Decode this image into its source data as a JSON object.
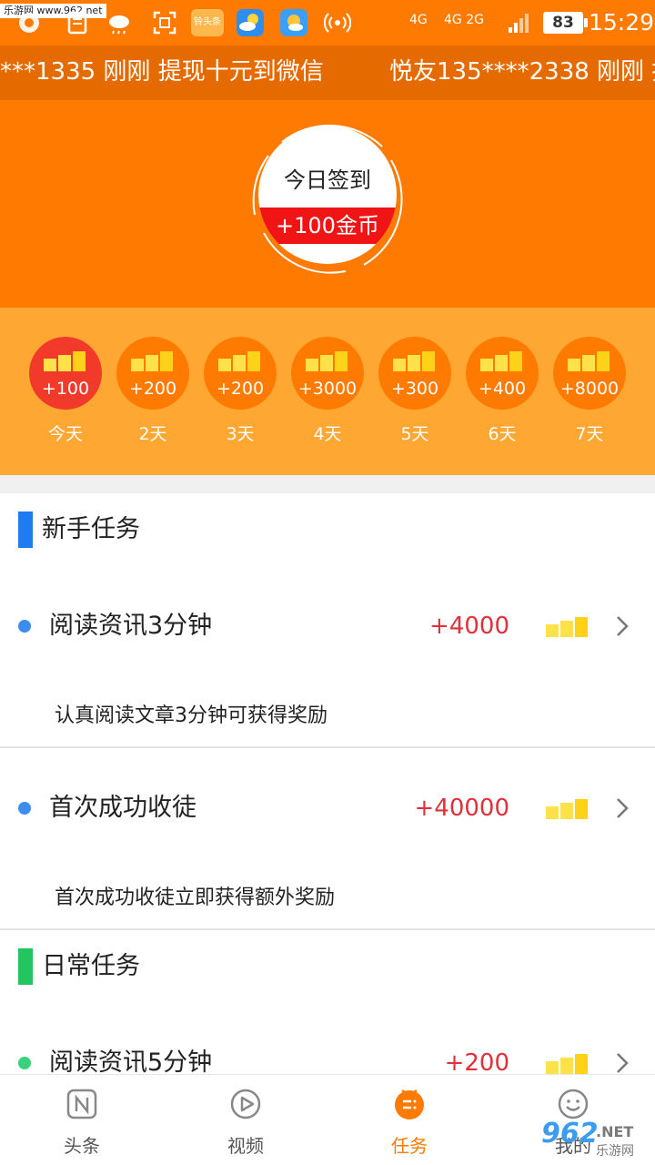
{
  "status_bar": {
    "watermark": "乐游网 www.962.net",
    "app_badge_text": "铃头条",
    "battery": "83",
    "network_1": "4G",
    "network_2": "4G 2G",
    "time": "15:29"
  },
  "ticker": {
    "items": [
      "***1335 刚刚 提现十元到微信",
      "悦友135****2338 刚刚 提"
    ]
  },
  "sign_in": {
    "title": "今日签到",
    "reward": "+100金币"
  },
  "streak": {
    "days": [
      {
        "amount": "+100",
        "label": "今天",
        "today": true
      },
      {
        "amount": "+200",
        "label": "2天",
        "today": false
      },
      {
        "amount": "+200",
        "label": "3天",
        "today": false
      },
      {
        "amount": "+3000",
        "label": "4天",
        "today": false
      },
      {
        "amount": "+300",
        "label": "5天",
        "today": false
      },
      {
        "amount": "+400",
        "label": "6天",
        "today": false
      },
      {
        "amount": "+8000",
        "label": "7天",
        "today": false
      }
    ]
  },
  "sections": {
    "newbie": {
      "title": "新手任务",
      "color": "#1e7bf2",
      "tasks": [
        {
          "title": "阅读资讯3分钟",
          "reward": "+4000",
          "desc": "认真阅读文章3分钟可获得奖励"
        },
        {
          "title": "首次成功收徒",
          "reward": "+40000",
          "desc": "首次成功收徒立即获得额外奖励"
        }
      ]
    },
    "daily": {
      "title": "日常任务",
      "color": "#22c55e",
      "tasks": [
        {
          "title": "阅读资讯5分钟",
          "reward": "+200"
        }
      ]
    }
  },
  "bottom_nav": {
    "items": [
      {
        "label": "头条",
        "icon": "news-icon"
      },
      {
        "label": "视频",
        "icon": "video-play-icon"
      },
      {
        "label": "任务",
        "icon": "task-icon",
        "active": true
      },
      {
        "label": "我的",
        "icon": "smiley-icon"
      }
    ]
  },
  "watermark_br": {
    "num": "962",
    "net": ".NET",
    "cn": "乐游网"
  },
  "colors": {
    "orange": "#ff7a00",
    "streak_bg": "#ffa733",
    "reward_red": "#e0303a",
    "band_red": "#f01414"
  }
}
